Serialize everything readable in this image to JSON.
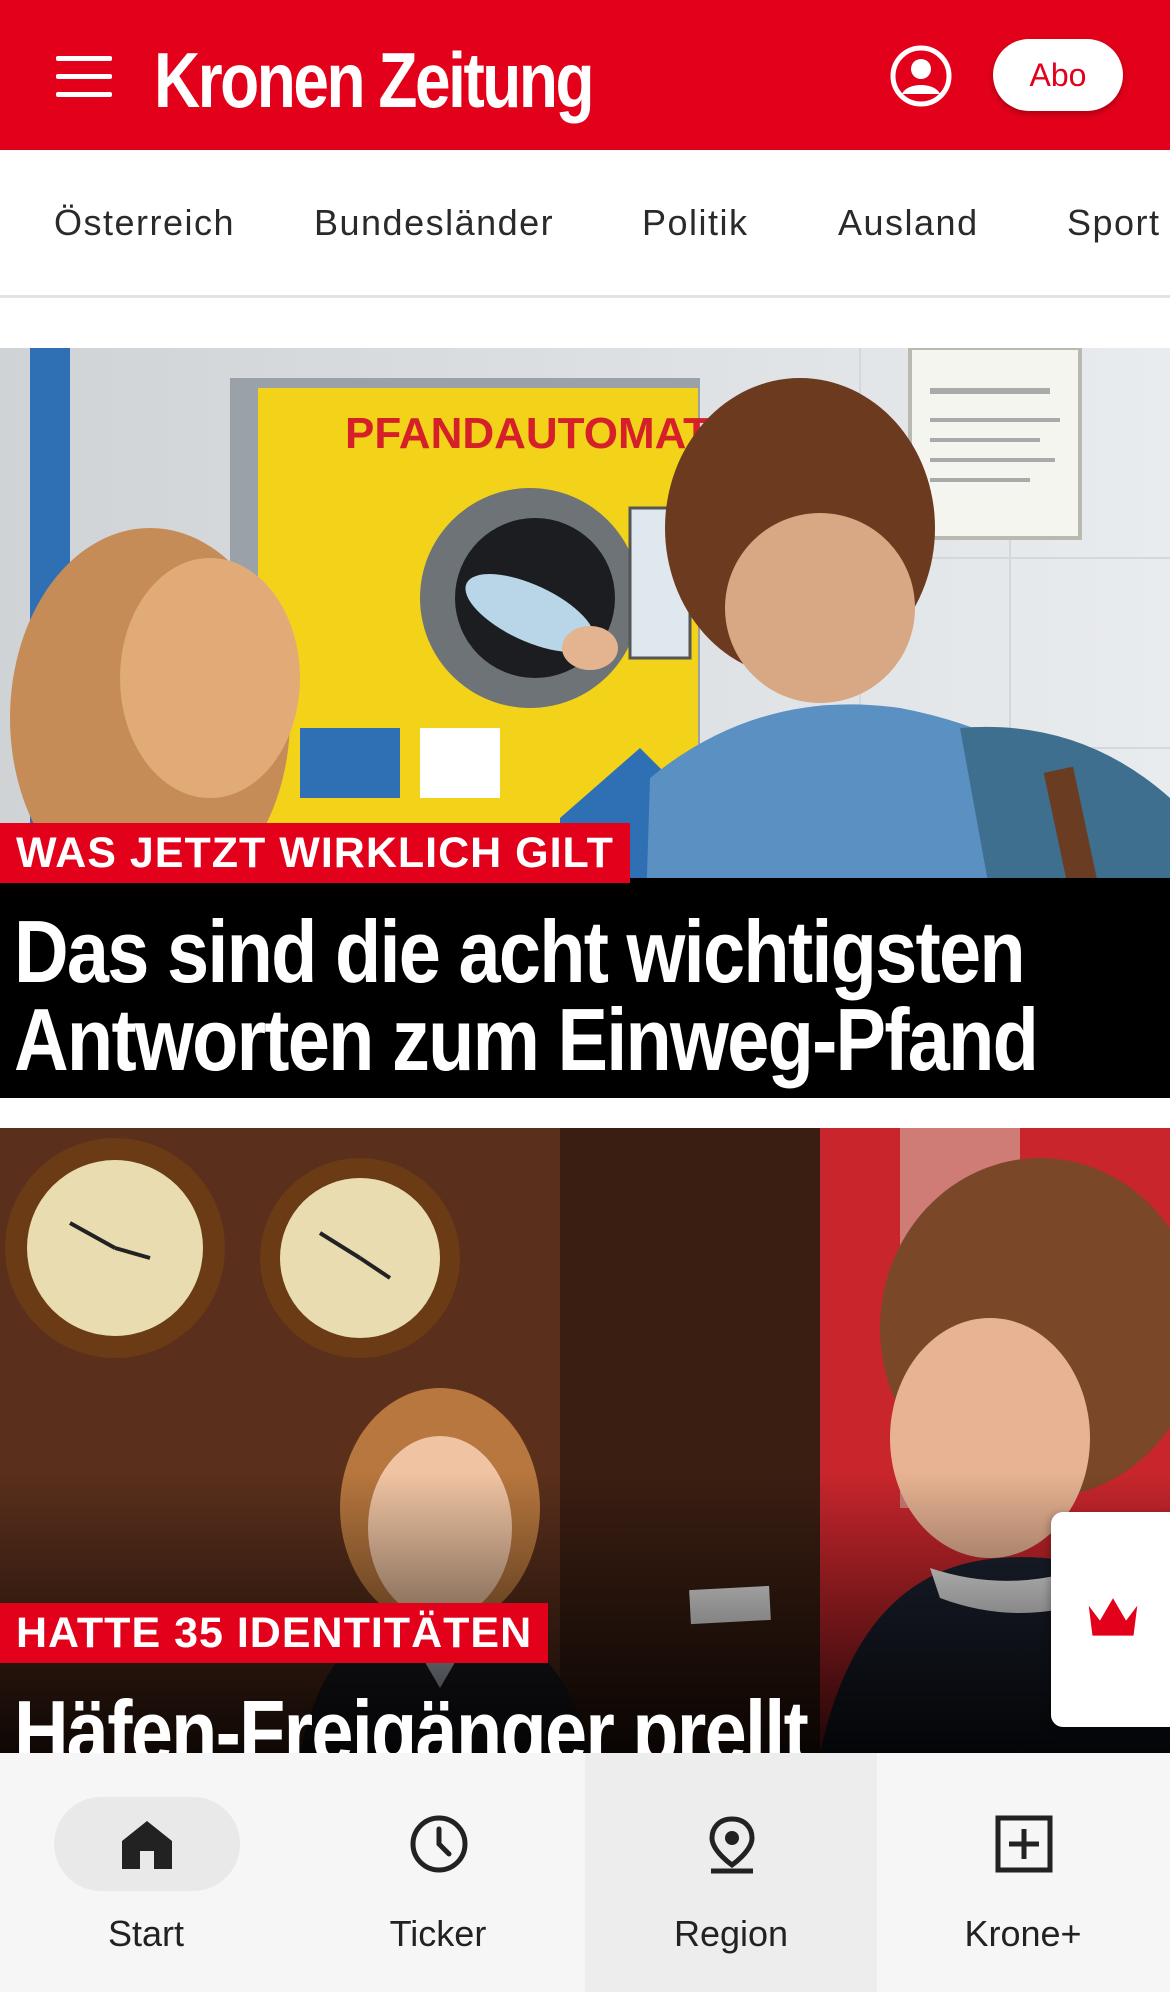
{
  "header": {
    "logo": "Kronen Zeitung",
    "abo_label": "Abo",
    "brand_color": "#e2001a",
    "icons": [
      "menu-icon",
      "account-icon"
    ]
  },
  "nav": {
    "items": [
      "Österreich",
      "Bundesländer",
      "Politik",
      "Ausland",
      "Sport"
    ]
  },
  "articles": [
    {
      "kicker": "WAS JETZT WIRKLICH GILT",
      "headline_line1": "Das sind die acht wichtigsten",
      "headline_line2": "Antworten zum Einweg-Pfand",
      "image_text": "PFANDAUTOMAT"
    },
    {
      "kicker": "HATTE 35 IDENTITÄTEN",
      "headline_line1": "Häfen-Freigänger prellt"
    }
  ],
  "side_button": {
    "icon": "crown-icon"
  },
  "bottom_nav": {
    "items": [
      {
        "label": "Start",
        "icon": "home-icon",
        "active": true
      },
      {
        "label": "Ticker",
        "icon": "clock-icon"
      },
      {
        "label": "Region",
        "icon": "location-pin-icon"
      },
      {
        "label": "Krone+",
        "icon": "plus-box-icon"
      }
    ]
  }
}
